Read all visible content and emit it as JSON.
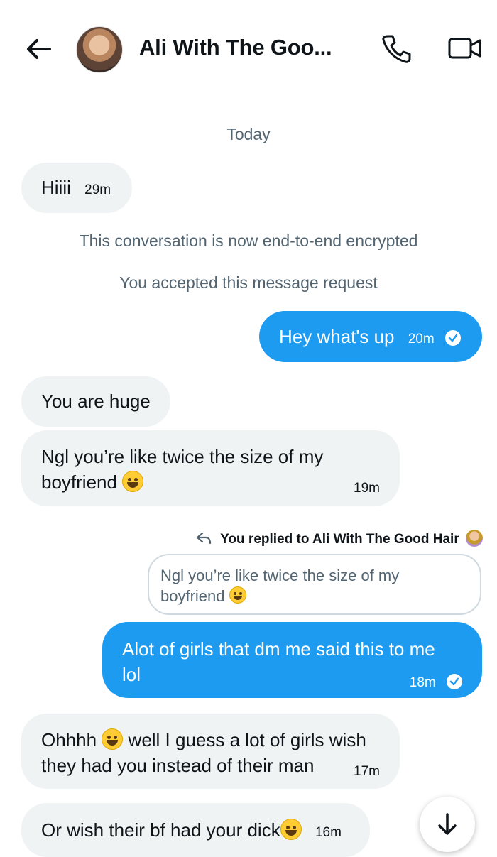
{
  "header": {
    "contact_name": "Ali With The Goo...",
    "icons": [
      "back-arrow-icon",
      "avatar",
      "phone-icon",
      "video-icon"
    ]
  },
  "conversation": {
    "day_label": "Today",
    "system_messages": [
      "This conversation is now end-to-end encrypted",
      "You accepted this message request"
    ],
    "messages": [
      {
        "direction": "in",
        "text": "Hiiii",
        "time": "29m"
      },
      {
        "direction": "out",
        "text": "Hey what's up",
        "time": "20m",
        "status_icon": "sent-check-icon"
      },
      {
        "direction": "in",
        "text": "You are huge",
        "time": ""
      },
      {
        "direction": "in",
        "text": "Ngl you’re like twice the size of my boyfriend",
        "line1": "Ngl you’re like twice the size of my",
        "line2": "boyfriend",
        "emoji": "sweat-smile-emoji",
        "time": "19m"
      },
      {
        "direction": "out",
        "text": "Alot of girls that dm me said this to me lol",
        "line1": "Alot of girls that dm me said this to me",
        "line2": "lol",
        "time": "18m",
        "status_icon": "sent-check-icon"
      },
      {
        "direction": "in",
        "line1_before": "Ohhhh",
        "line1_after": "well I guess a lot of girls wish",
        "line2": "they had you instead of their man",
        "emoji": "laughing-tears-emoji",
        "time": "17m"
      },
      {
        "direction": "in",
        "text": "Or wish their bf had your dick",
        "emoji": "shushing-face-emoji",
        "time": "16m"
      }
    ],
    "reply_note": "You replied to Ali With The Good Hair",
    "quoted_message": {
      "line1": "Ngl you’re like twice the size of my",
      "line2": "boyfriend",
      "emoji": "sweat-smile-emoji"
    }
  },
  "scroll_button": {
    "icon": "arrow-down-icon"
  },
  "colors": {
    "outgoing_bubble": "#1d9bf0",
    "incoming_bubble": "#eff3f4",
    "secondary_text": "#536471"
  }
}
